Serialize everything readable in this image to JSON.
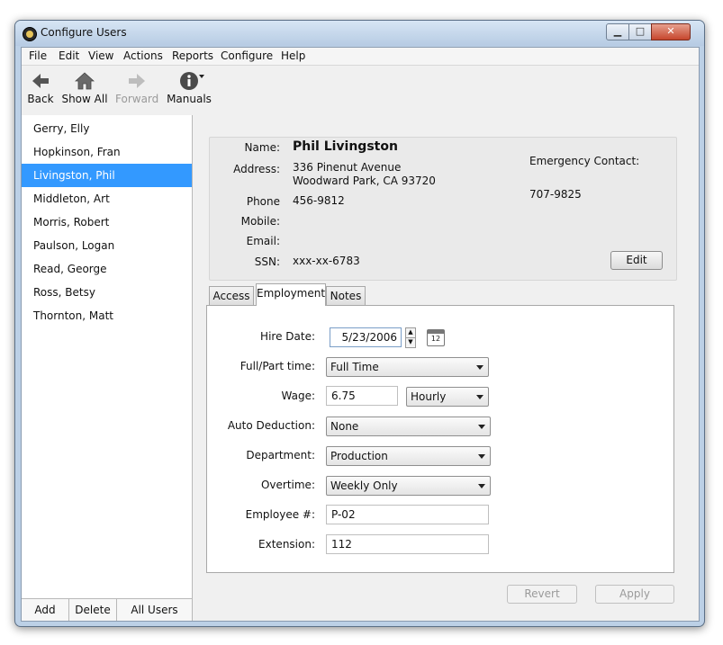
{
  "window": {
    "title": "Configure Users",
    "icon": "app-globe-icon"
  },
  "menu": [
    "File",
    "Edit",
    "View",
    "Actions",
    "Reports",
    "Configure",
    "Help"
  ],
  "toolbar": {
    "back": "Back",
    "show_all": "Show All",
    "forward": "Forward",
    "manuals": "Manuals"
  },
  "users": [
    "Gerry, Elly",
    "Hopkinson, Fran",
    "Livingston, Phil",
    "Middleton, Art",
    "Morris, Robert",
    "Paulson, Logan",
    "Read, George",
    "Ross, Betsy",
    "Thornton, Matt"
  ],
  "selected_user": "Livingston, Phil",
  "sidebar_footer": {
    "add": "Add",
    "delete": "Delete",
    "all_users": "All Users"
  },
  "info": {
    "name_label": "Name:",
    "name": "Phil Livingston",
    "address_label": "Address:",
    "address_line1": "336 Pinenut Avenue",
    "address_line2": "Woodward Park, CA 93720",
    "phone_label": "Phone",
    "phone": "456-9812",
    "mobile_label": "Mobile:",
    "email_label": "Email:",
    "ssn_label": "SSN:",
    "ssn": "xxx-xx-6783",
    "emergency_label": "Emergency Contact:",
    "emergency": "707-9825",
    "edit_button": "Edit"
  },
  "tabs": [
    "Access",
    "Employment",
    "Notes"
  ],
  "active_tab": "Employment",
  "employment": {
    "hire_date_label": "Hire Date:",
    "hire_date": "5/23/2006",
    "calendar_day": "12",
    "full_part_label": "Full/Part time:",
    "full_part": "Full Time",
    "wage_label": "Wage:",
    "wage": "6.75",
    "wage_unit": "Hourly",
    "auto_deduction_label": "Auto Deduction:",
    "auto_deduction": "None",
    "department_label": "Department:",
    "department": "Production",
    "overtime_label": "Overtime:",
    "overtime": "Weekly Only",
    "employee_no_label": "Employee #:",
    "employee_no": "P-02",
    "extension_label": "Extension:",
    "extension": "112"
  },
  "actions": {
    "revert": "Revert",
    "apply": "Apply"
  }
}
